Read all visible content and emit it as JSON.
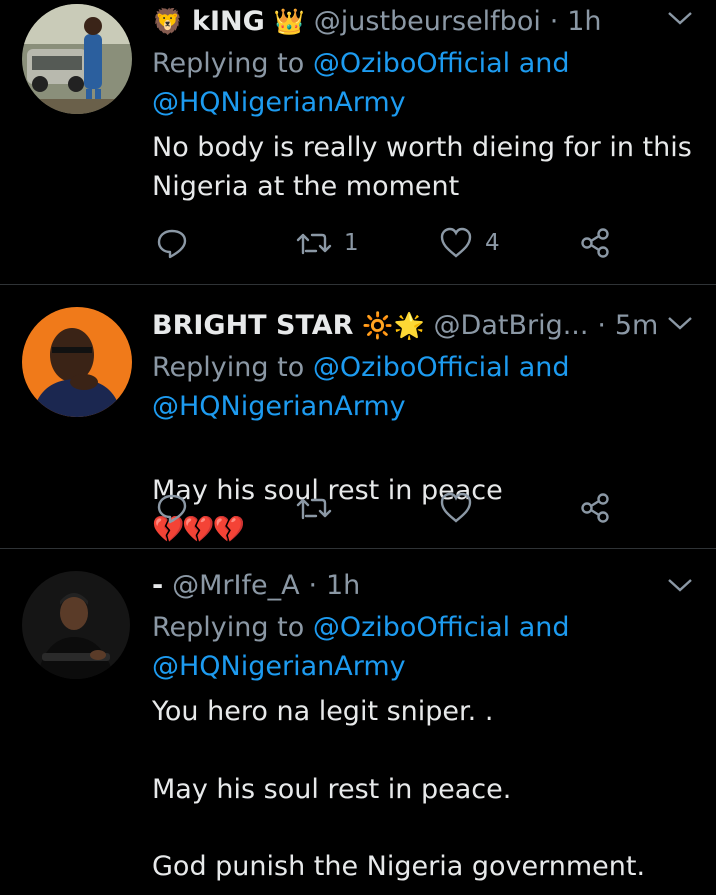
{
  "tweets": [
    {
      "name": "kING",
      "name_emoji_before": "🦁",
      "name_emoji_after": "👑",
      "handle": "@justbeurselfboi",
      "time": "1h",
      "reply_prefix": "Replying to",
      "reply_user1": "@OziboOfficial",
      "reply_and": "and",
      "reply_user2": "@HQNigerianArmy",
      "text": "No body is really worth dieing for in this\nNigeria at the moment",
      "replies": "",
      "retweets": "1",
      "likes": "4",
      "avatar_icon": "user-avatar-woman-with-car"
    },
    {
      "name": "BRIGHT STAR",
      "name_emoji_after": "🔆🌟",
      "handle": "@DatBrig...",
      "time": "5m",
      "reply_prefix": "Replying to",
      "reply_user1": "@OziboOfficial",
      "reply_and": "and",
      "reply_user2": "@HQNigerianArmy",
      "text": "May his soul rest in peace",
      "text_emoji": "💔💔💔",
      "replies": "",
      "retweets": "",
      "likes": "",
      "avatar_icon": "user-avatar-man-orange-bg"
    },
    {
      "name": "-",
      "handle": "@MrIfe_A",
      "time": "1h",
      "reply_prefix": "Replying to",
      "reply_user1": "@OziboOfficial",
      "reply_and": "and",
      "reply_user2": "@HQNigerianArmy",
      "text_line1": "You hero na legit sniper. .",
      "text_line2": "May his soul rest in peace.",
      "text_line3": "God punish the Nigeria government.",
      "avatar_icon": "user-avatar-man-dark-bg"
    }
  ],
  "separator_dot": "·",
  "colors": {
    "background": "#000000",
    "link": "#1d9bf0",
    "muted": "#8b98a5",
    "text": "#e7e9ea"
  }
}
